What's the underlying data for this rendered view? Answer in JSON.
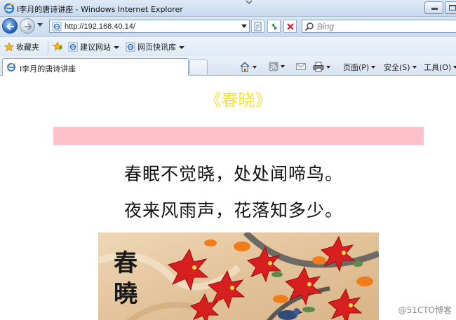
{
  "window": {
    "title": "I李月的唐诗讲座 - Windows Internet Explorer"
  },
  "address_bar": {
    "url": "http://192.168.40.14/",
    "search_placeholder": "Bing"
  },
  "favorites_bar": {
    "favorites_label": "收藏夹",
    "items": [
      {
        "label": "建议网站",
        "icon": "suggested-sites-icon"
      },
      {
        "label": "网页快讯库",
        "icon": "web-slice-icon"
      }
    ]
  },
  "tab": {
    "label": "I李月的唐诗讲座"
  },
  "command_bar": {
    "page_label": "页面(P)",
    "safety_label": "安全(S)",
    "tools_label": "工具(O)"
  },
  "page": {
    "poem_title": "《春晓》",
    "verses": [
      "春眠不觉晓，处处闻啼鸟。",
      "夜来风雨声，花落知多少。"
    ],
    "painting_calligraphy": [
      "春",
      "曉"
    ],
    "watermark": "@51CTO博客"
  },
  "colors": {
    "title_yellow": "#f5e23a",
    "pink_bar": "#ffc0cb",
    "ie_chrome": "#d6e3f3"
  }
}
